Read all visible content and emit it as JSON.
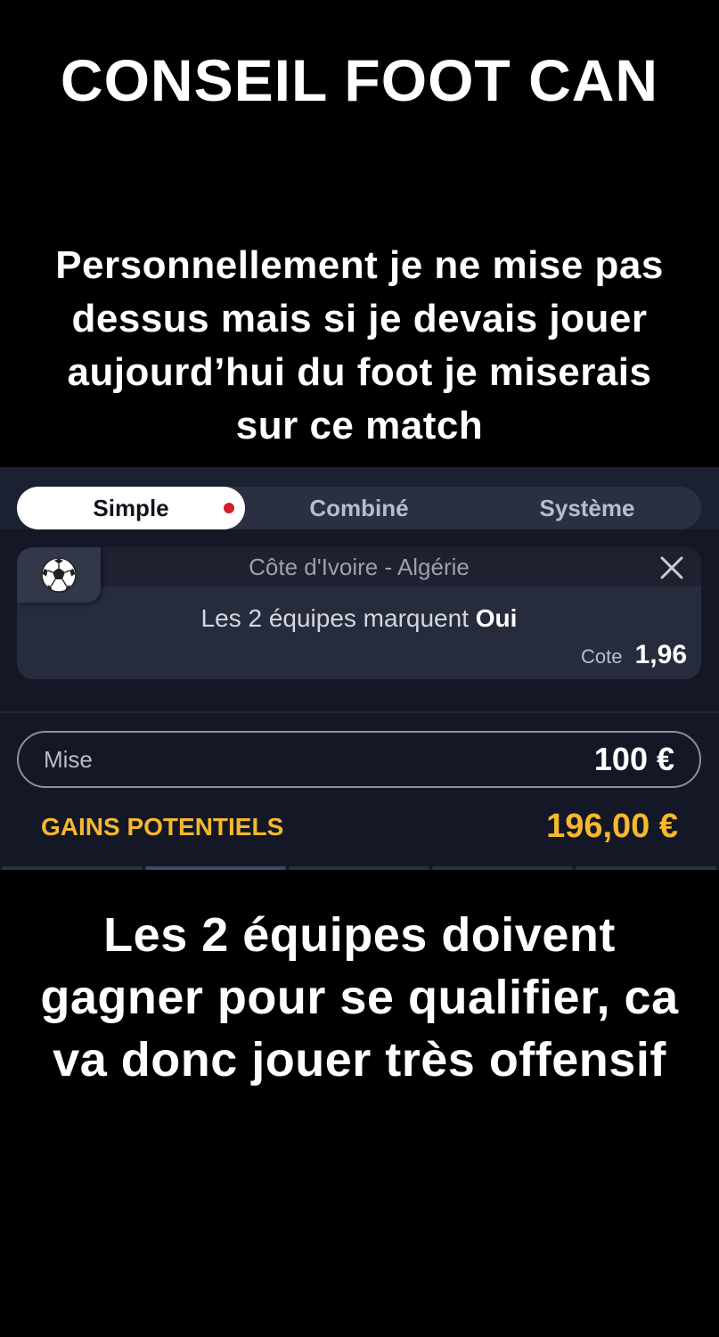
{
  "overlay": {
    "title": "CONSEIL FOOT CAN",
    "caption_top": "Personnellement je ne mise pas dessus mais si je devais jouer aujourd’hui du foot je miserais sur ce match",
    "caption_bottom": "Les 2 équipes doivent gagner pour se qualifier, ca va donc jouer très offensif"
  },
  "betslip": {
    "tabs": [
      {
        "label": "Simple",
        "active": true
      },
      {
        "label": "Combiné",
        "active": false
      },
      {
        "label": "Système",
        "active": false
      }
    ],
    "selection": {
      "match": "Côte d'Ivoire - Algérie",
      "market": "Les 2 équipes marquent",
      "pick": "Oui",
      "odds_label": "Cote",
      "odds_value": "1,96"
    },
    "stake": {
      "label": "Mise",
      "value": "100 €"
    },
    "potential_gains": {
      "label": "GAINS POTENTIELS",
      "value": "196,00 €"
    },
    "colors": {
      "gains": "#f5b82e",
      "active_dot": "#d21f2b",
      "panel_bg": "#141826"
    }
  }
}
